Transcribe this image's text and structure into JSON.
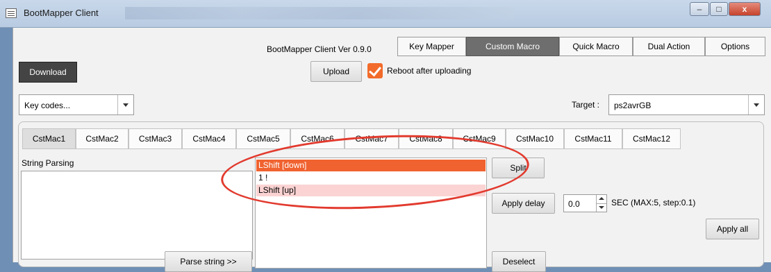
{
  "window": {
    "title": "BootMapper Client",
    "minimize": "–",
    "maximize": "□",
    "close": "x"
  },
  "header": {
    "version": "BootMapper Client Ver 0.9.0",
    "tabs": [
      {
        "label": "Key Mapper",
        "active": false
      },
      {
        "label": "Custom Macro",
        "active": true
      },
      {
        "label": "Quick Macro",
        "active": false
      },
      {
        "label": "Dual Action",
        "active": false
      },
      {
        "label": "Options",
        "active": false
      }
    ]
  },
  "toolbar": {
    "download": "Download",
    "upload": "Upload",
    "reboot_label": "Reboot after uploading",
    "reboot_checked": true
  },
  "keycodes": {
    "value": "Key codes..."
  },
  "target": {
    "label": "Target :",
    "value": "ps2avrGB"
  },
  "macro_tabs": [
    {
      "label": "CstMac1",
      "active": true
    },
    {
      "label": "CstMac2"
    },
    {
      "label": "CstMac3"
    },
    {
      "label": "CstMac4"
    },
    {
      "label": "CstMac5"
    },
    {
      "label": "CstMac6"
    },
    {
      "label": "CstMac7"
    },
    {
      "label": "CstMac8"
    },
    {
      "label": "CstMac9"
    },
    {
      "label": "CstMac10"
    },
    {
      "label": "CstMac11"
    },
    {
      "label": "CstMac12"
    }
  ],
  "string_parsing": {
    "label": "String Parsing",
    "value": "",
    "parse_button": "Parse string >>"
  },
  "macro_list": [
    {
      "text": "LShift [down]",
      "state": "selected"
    },
    {
      "text": "1 !",
      "state": "normal"
    },
    {
      "text": "LShift [up]",
      "state": "highlight"
    }
  ],
  "actions": {
    "split": "Split",
    "apply_delay": "Apply delay",
    "delay_value": "0.0",
    "delay_hint": "SEC (MAX:5, step:0.1)",
    "apply_all": "Apply all",
    "deselect": "Deselect"
  },
  "colors": {
    "accent": "#f26b2a",
    "selected_row": "#f0622f",
    "highlight_row": "#fbd3d3",
    "annotation": "#e23a2e"
  }
}
